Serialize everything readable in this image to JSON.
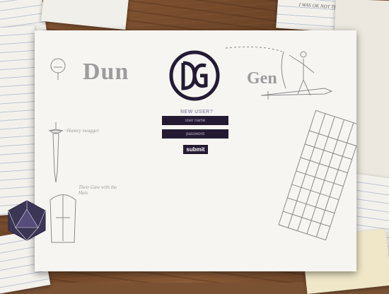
{
  "login": {
    "new_user_label": "NEW USER?",
    "username_placeholder": "user name",
    "password_placeholder": "password",
    "submit_label": "submit"
  },
  "sketch": {
    "dun_text": "Dun",
    "gen_text": "Gen",
    "dagger_note": "~Hamey swagger",
    "helmet_note": "Their Gaw with the Hats",
    "corner_note": "I WAS OK NOT TELL"
  },
  "colors": {
    "accent": "#241b33",
    "label": "#9c93ad",
    "paper": "#f6f5f2",
    "desk": "#7a5233"
  }
}
